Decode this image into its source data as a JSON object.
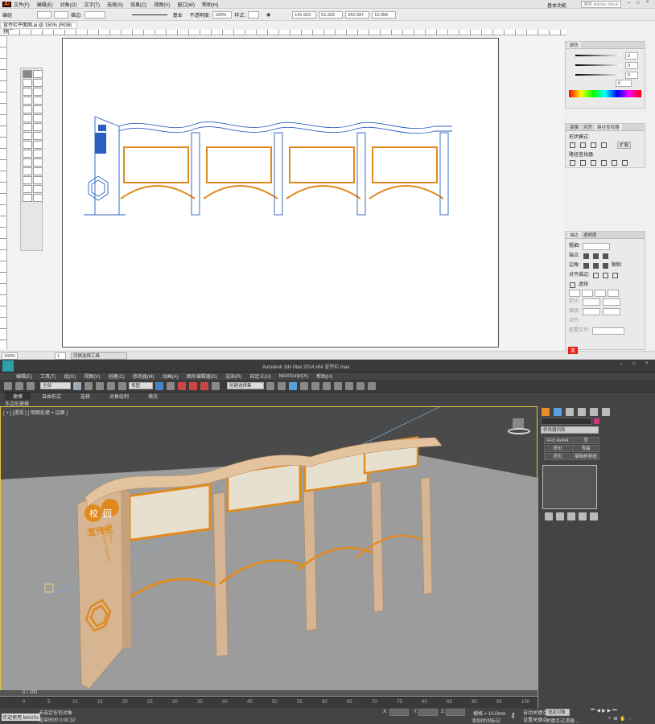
{
  "illustrator": {
    "logo": "Ai",
    "menus": [
      "文件(F)",
      "编辑(E)",
      "对象(O)",
      "文字(T)",
      "选择(S)",
      "效果(C)",
      "视图(V)",
      "窗口(W)",
      "帮助(H)"
    ],
    "workspace": "基本功能",
    "search_placeholder": "搜索 Adobe Stock",
    "control": {
      "mode": "编组",
      "stroke_label": "描边:",
      "style": "基本",
      "opacity_label": "不透明度:",
      "opacity": "100%",
      "style_label": "样式:",
      "x": "141.923",
      "y": "51.926",
      "w": "252.697",
      "h": "10.956"
    },
    "doc_tab": "宣传栏平面图.ai @ 150% (RGB/预览)",
    "status": {
      "zoom": "150%",
      "page": "1",
      "tool_info": "切换选择工具"
    },
    "color_panel": {
      "title": "颜色",
      "values": [
        "0",
        "0",
        "0"
      ],
      "hex": "0"
    },
    "pathfinder": {
      "tabs": [
        "变换",
        "对齐",
        "路径查找器"
      ],
      "shape_modes": "形状模式:",
      "pathfinders": "路径查找器:",
      "expand": "扩展"
    },
    "stroke_panel": {
      "tabs": [
        "描边",
        "透明度"
      ],
      "weight_label": "粗细:",
      "cap_label": "端点:",
      "corner_label": "边角:",
      "limit_label": "限制:",
      "align_label": "对齐描边:",
      "dashed": "虚线",
      "start_label": "箭头:",
      "scale_label": "缩放:",
      "align2_label": "对齐:",
      "profile_label": "配置文件:"
    },
    "ime": "英"
  },
  "max": {
    "title": "Autodesk 3ds Max  2014 x64    宣传栏.max",
    "menus": [
      "编辑(E)",
      "工具(T)",
      "组(G)",
      "视图(V)",
      "创建(C)",
      "修改器(M)",
      "动画(A)",
      "图形编辑器(D)",
      "渲染(R)",
      "自定义(U)",
      "MAXScript(X)",
      "帮助(H)"
    ],
    "selection_filter": "全部",
    "ref_coord": "视图",
    "named_sel": "创建选择集",
    "ribbon_tabs": [
      "建模",
      "自由形式",
      "选择",
      "对象绘制",
      "填充"
    ],
    "ribbon_sub": "多边形建模",
    "viewport_label": "[ + ] [透视 ] [ 明暗处理 + 边面 ]",
    "modifier_list": "修改器列表",
    "cmd_buttons": [
      "FFD 4x4x4",
      "壳",
      "挤出",
      "弯曲",
      "挤出",
      "编辑样条线"
    ],
    "board_text": {
      "top": "校园",
      "main": "宣传栏",
      "eng1": "Campus",
      "eng2": "Bulletin board"
    },
    "timeline": {
      "frame": "0 / 100",
      "ticks": [
        "0",
        "5",
        "10",
        "15",
        "20",
        "25",
        "30",
        "35",
        "40",
        "45",
        "50",
        "55",
        "60",
        "65",
        "70",
        "75",
        "80",
        "85",
        "90",
        "95",
        "100"
      ]
    },
    "status": {
      "welcome": "欢迎使用 MAXSc",
      "line1": "未选定任何对象",
      "line2": "渲染时间 0:00:32",
      "grid": "栅格 = 10.0mm",
      "auto_key": "自动关键点",
      "set_key": "设置关键点",
      "filter": "关键点过滤器...",
      "sel_obj": "选定对象",
      "add_tag": "添加时间标记",
      "x_label": "X:",
      "y_label": "Y:",
      "z_label": "Z:"
    }
  },
  "colors": {
    "orange": "#e08a1e",
    "blue": "#2b5fbf",
    "wood": "#d7b593",
    "panel": "#c9b79c"
  }
}
